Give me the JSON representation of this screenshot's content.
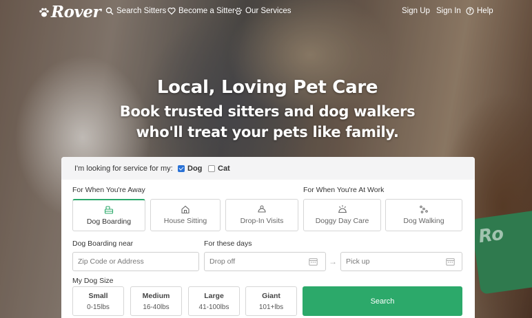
{
  "brand": {
    "name": "Rover",
    "accent": "#2ca96a"
  },
  "nav": {
    "search_sitters": "Search Sitters",
    "become_sitter": "Become a Sitter",
    "our_services": "Our Services",
    "sign_up": "Sign Up",
    "sign_in": "Sign In",
    "help": "Help"
  },
  "hero": {
    "title": "Local, Loving Pet Care",
    "subtitle_line1": "Book trusted sitters and dog walkers",
    "subtitle_line2": "who'll treat your pets like family.",
    "shirt_text": "Ro"
  },
  "search": {
    "pet_prompt": "I'm looking for service for my:",
    "pets": [
      {
        "label": "Dog",
        "checked": true
      },
      {
        "label": "Cat",
        "checked": false
      }
    ],
    "away_label": "For When You're Away",
    "work_label": "For When You're At Work",
    "services": [
      {
        "label": "Dog Boarding",
        "icon": "dog-boarding-icon",
        "selected": true
      },
      {
        "label": "House Sitting",
        "icon": "house-sitting-icon",
        "selected": false
      },
      {
        "label": "Drop-In Visits",
        "icon": "drop-in-icon",
        "selected": false
      },
      {
        "label": "Doggy Day Care",
        "icon": "day-care-icon",
        "selected": false
      },
      {
        "label": "Dog Walking",
        "icon": "dog-walking-icon",
        "selected": false
      }
    ],
    "location_label": "Dog Boarding near",
    "location_placeholder": "Zip Code or Address",
    "dates_label": "For these days",
    "dropoff_placeholder": "Drop off",
    "pickup_placeholder": "Pick up",
    "size_label": "My Dog Size",
    "sizes": [
      {
        "name": "Small",
        "range": "0-15lbs"
      },
      {
        "name": "Medium",
        "range": "16-40lbs"
      },
      {
        "name": "Large",
        "range": "41-100lbs"
      },
      {
        "name": "Giant",
        "range": "101+lbs"
      }
    ],
    "search_button": "Search"
  }
}
